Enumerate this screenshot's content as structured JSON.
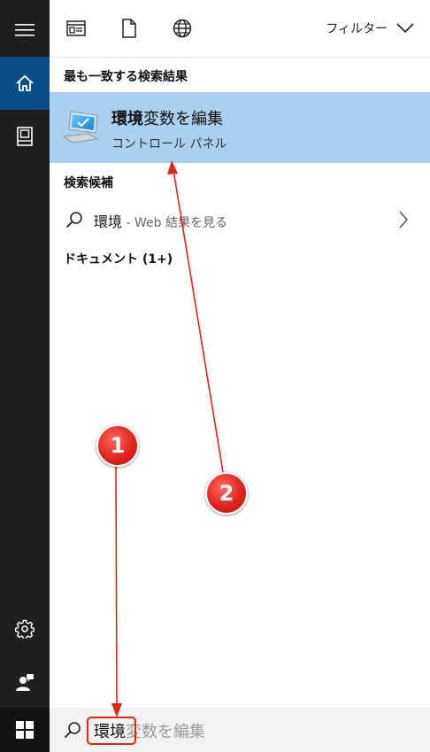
{
  "topbar": {
    "filter_label": "フィルター"
  },
  "best_match": {
    "section_label": "最も一致する検索結果",
    "title_bold": "環境",
    "title_rest": "変数を編集",
    "subtitle": "コントロール パネル"
  },
  "suggestions": {
    "section_label": "検索候補",
    "query": "環境",
    "suffix": " - Web 結果を見る"
  },
  "documents": {
    "section_label": "ドキュメント (1+)"
  },
  "search": {
    "typed": "環境",
    "completion": "変数を編集"
  },
  "annotations": {
    "badge1": "1",
    "badge2": "2"
  },
  "colors": {
    "accent": "#0a4f89",
    "highlight": "#a9d0ee",
    "annotation_red": "#e0241c"
  }
}
